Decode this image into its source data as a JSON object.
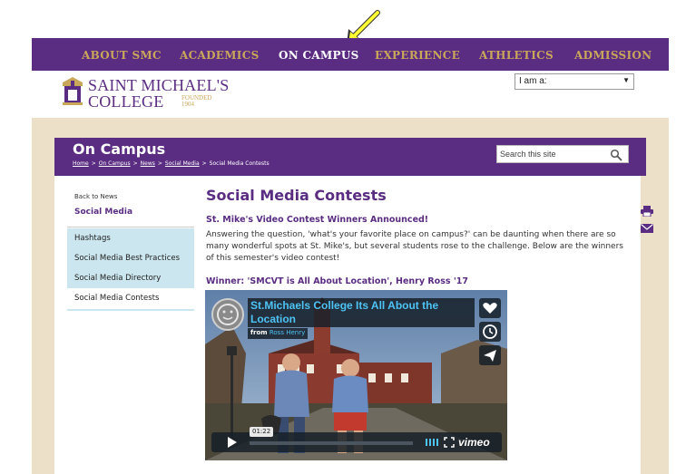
{
  "nav": {
    "items": [
      {
        "label": "ABOUT SMC",
        "active": false
      },
      {
        "label": "ACADEMICS",
        "active": false
      },
      {
        "label": "ON CAMPUS",
        "active": true
      },
      {
        "label": "EXPERIENCE",
        "active": false
      },
      {
        "label": "ATHLETICS",
        "active": false
      },
      {
        "label": "ADMISSION",
        "active": false
      }
    ]
  },
  "logo": {
    "line1": "SAINT MICHAEL'S",
    "line2": "COLLEGE",
    "founded": "FOUNDED",
    "year": "1904"
  },
  "iam": {
    "label": "I am a:"
  },
  "page": {
    "title": "On Campus",
    "breadcrumb": [
      "Home",
      "On Campus",
      "News",
      "Social Media",
      "Social Media Contests"
    ]
  },
  "search": {
    "placeholder": "Search this site"
  },
  "sidebar": {
    "back": "Back to News",
    "heading": "Social Media",
    "items": [
      {
        "label": "Hashtags",
        "current": false
      },
      {
        "label": "Social Media Best Practices",
        "current": false
      },
      {
        "label": "Social Media Directory",
        "current": false
      },
      {
        "label": "Social Media Contests",
        "current": true
      }
    ]
  },
  "main": {
    "title": "Social Media Contests",
    "subheading": "St. Mike's Video Contest Winners Announced!",
    "body": "Answering the question, 'what's your favorite place on campus?' can be daunting when there are so many wonderful spots at St. Mike's, but several students rose to the challenge. Below are the winners of this semester's video contest!",
    "winner": "Winner: 'SMCVT is All About Location', Henry Ross '17"
  },
  "video": {
    "title": "St.Michaels College Its All About the Location",
    "from_label": "from",
    "author": "Ross Henry",
    "time": "01:22",
    "brand": "vimeo"
  },
  "colors": {
    "purple": "#5a2d82",
    "gold": "#c9a75a",
    "beige": "#ece0c9",
    "sidenav_bg": "#cbe6ee",
    "annotation_arrow": "#ffff33"
  }
}
